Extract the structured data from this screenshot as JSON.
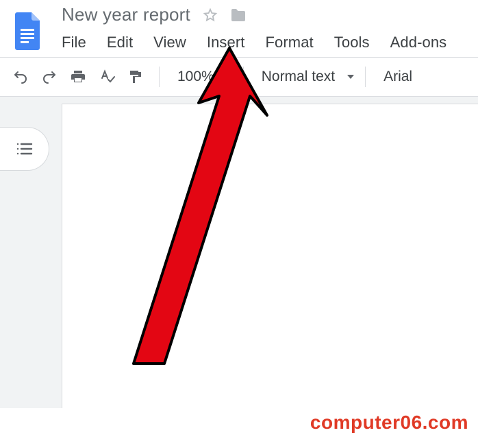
{
  "header": {
    "doc_title": "New year report"
  },
  "menu": {
    "items": [
      "File",
      "Edit",
      "View",
      "Insert",
      "Format",
      "Tools",
      "Add-ons"
    ]
  },
  "toolbar": {
    "zoom": "100%",
    "style": "Normal text",
    "font": "Arial"
  },
  "watermark": {
    "text": "computer06.com"
  }
}
